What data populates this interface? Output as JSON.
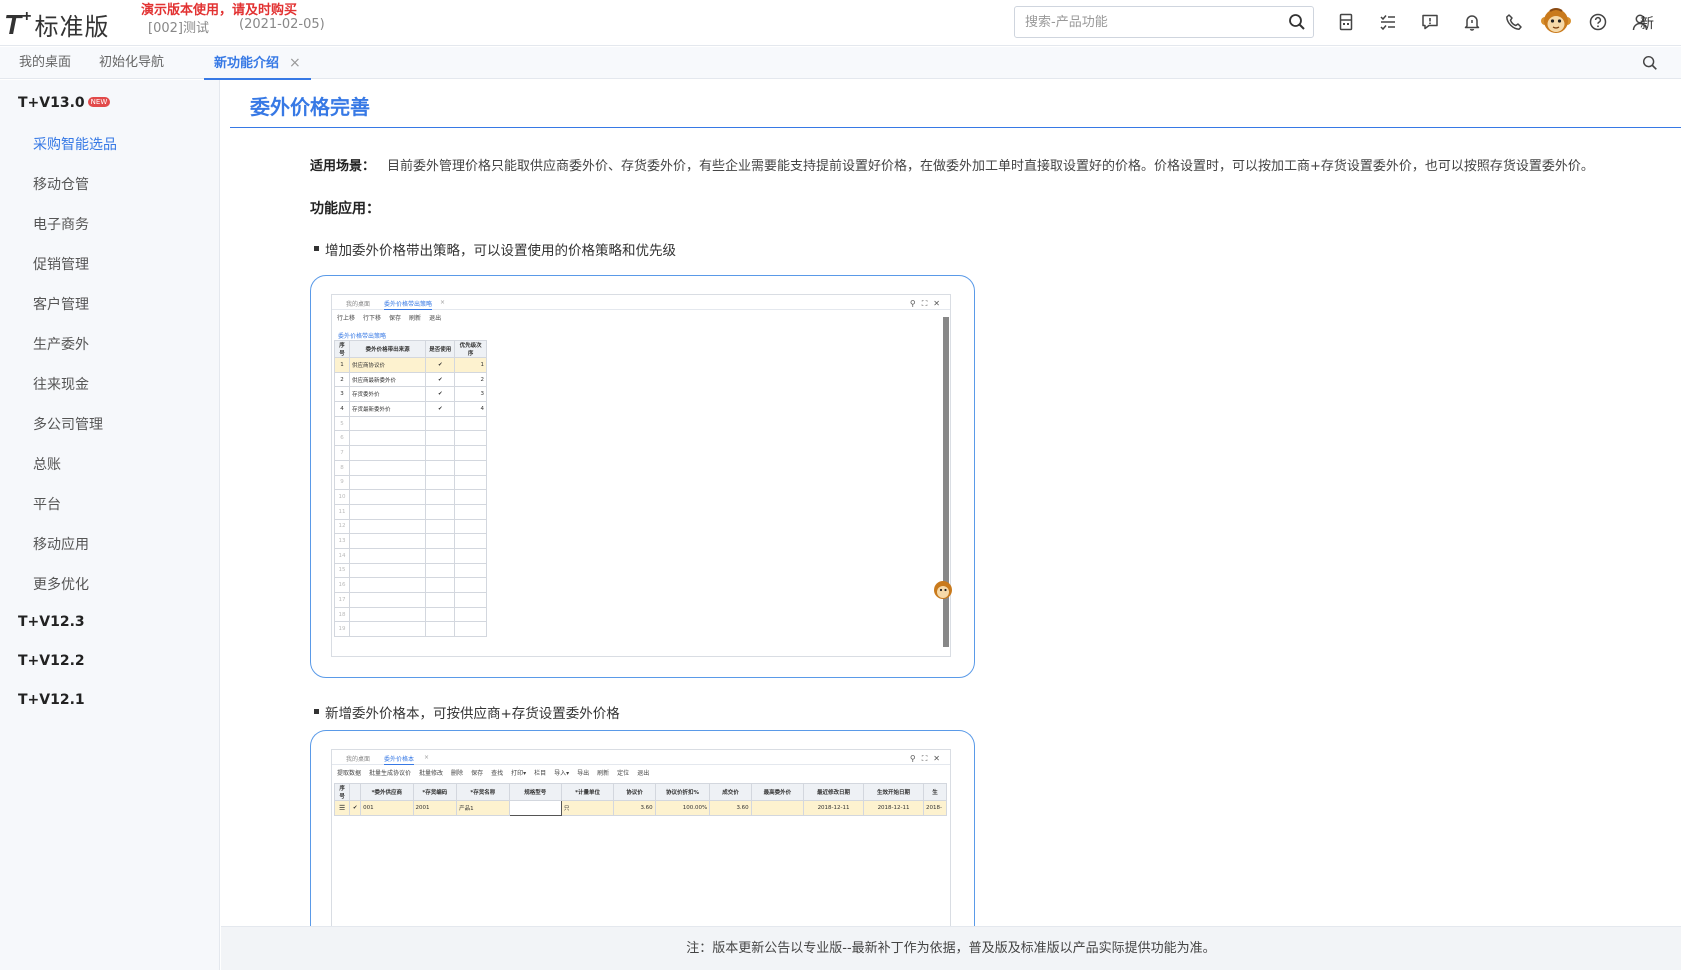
{
  "header": {
    "logo_t": "T",
    "logo_plus": "+",
    "logo_edition": "标准版",
    "demo_notice": "演示版本使用，请及时购买",
    "account": "[002]测试",
    "date": "(2021-02-05)",
    "search_placeholder": "搜索-产品功能",
    "more_text": "新"
  },
  "tabs": [
    {
      "label": "我的桌面"
    },
    {
      "label": "初始化导航"
    },
    {
      "label": "新功能介绍",
      "close": "×"
    }
  ],
  "sidebar": {
    "v13": {
      "label": "T+V13.0",
      "badge": "NEW"
    },
    "items": [
      {
        "label": "采购智能选品"
      },
      {
        "label": "移动仓管"
      },
      {
        "label": "电子商务"
      },
      {
        "label": "促销管理"
      },
      {
        "label": "客户管理"
      },
      {
        "label": "生产委外"
      },
      {
        "label": "往来现金"
      },
      {
        "label": "多公司管理"
      },
      {
        "label": "总账"
      },
      {
        "label": "平台"
      },
      {
        "label": "移动应用"
      },
      {
        "label": "更多优化"
      }
    ],
    "versions": [
      {
        "label": "T+V12.3"
      },
      {
        "label": "T+V12.2"
      },
      {
        "label": "T+V12.1"
      }
    ]
  },
  "content": {
    "title": "委外价格完善",
    "scene_label": "适用场景：",
    "scene_text": "目前委外管理价格只能取供应商委外价、存货委外价，有些企业需要能支持提前设置好价格，在做委外加工单时直接取设置好的价格。价格设置时，可以按加工商+存货设置委外价，也可以按照存货设置委外价。",
    "func_label": "功能应用：",
    "bullet1": "增加委外价格带出策略，可以设置使用的价格策略和优先级",
    "bullet2": "新增委外价格本，可按供应商+存货设置委外价格"
  },
  "shot1": {
    "tab1": "我的桌面",
    "tab2": "委外价格带出策略",
    "tab_close": "×",
    "toolbar": [
      "行上移",
      "行下移",
      "保存",
      "刷新",
      "退出"
    ],
    "subtab": "委外价格带出策略",
    "columns": [
      "序号",
      "委外价格带出来源",
      "是否使用",
      "优先级次序"
    ],
    "rows": [
      {
        "no": "1",
        "source": "供应商协议价",
        "used": "✔",
        "order": "1"
      },
      {
        "no": "2",
        "source": "供应商最新委外价",
        "used": "✔",
        "order": "2"
      },
      {
        "no": "3",
        "source": "存货委外价",
        "used": "✔",
        "order": "3"
      },
      {
        "no": "4",
        "source": "存货最新委外价",
        "used": "✔",
        "order": "4"
      }
    ],
    "empty_rows": [
      "5",
      "6",
      "7",
      "8",
      "9",
      "10",
      "11",
      "12",
      "13",
      "14",
      "15",
      "16",
      "17",
      "18",
      "19"
    ]
  },
  "shot2": {
    "tab1": "我的桌面",
    "tab2": "委外价格本",
    "tab_close": "×",
    "toolbar": [
      "提取数据",
      "批量生成协议价",
      "批量修改",
      "删除",
      "保存",
      "查找",
      "打印▾",
      "栏目",
      "导入▾",
      "导出",
      "刷新",
      "定位",
      "退出"
    ],
    "columns": [
      "序号",
      "",
      "*委外供应商",
      "*存货编码",
      "*存货名称",
      "规格型号",
      "*计量单位",
      "协议价",
      "协议价折扣%",
      "成交价",
      "最高委外价",
      "最近修改日期",
      "生效开始日期",
      "生"
    ],
    "row": [
      "",
      "✔",
      "001",
      "2001",
      "产品1",
      "",
      "只",
      "3.60",
      "100.00%",
      "3.60",
      "",
      "2018-12-11",
      "2018-12-11",
      "2018-"
    ]
  },
  "footer": {
    "note": "注：版本更新公告以专业版--最新补丁作为依据，普及版及标准版以产品实际提供功能为准。"
  },
  "colors": {
    "accent": "#3779e5",
    "demo_red": "#e23232",
    "badge_red": "#e24a4a",
    "row_highlight": "#fdf2cf"
  }
}
